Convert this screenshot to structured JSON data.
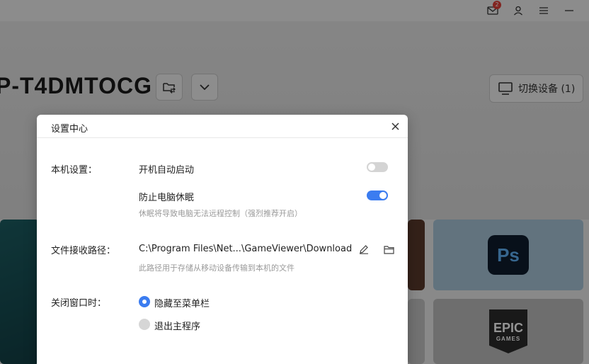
{
  "topbar": {
    "mail_badge": "2",
    "icons": [
      "mail-icon",
      "user-icon",
      "menu-icon",
      "minimize-icon"
    ]
  },
  "device": {
    "name": "P-T4DMTOCG",
    "switch_label": "切换设备 (1)"
  },
  "apps": {
    "ps_label": "Ps",
    "epic_line1": "EPIC",
    "epic_line2": "GAMES"
  },
  "dialog": {
    "title": "设置中心",
    "local_settings": {
      "label": "本机设置：",
      "autostart_label": "开机自动启动",
      "autostart_enabled": false,
      "prevent_sleep_label": "防止电脑休眠",
      "prevent_sleep_enabled": true,
      "prevent_sleep_hint": "休眠将导致电脑无法远程控制（强烈推荐开启）"
    },
    "file_path": {
      "label": "文件接收路径：",
      "value": "C:\\Program Files\\Net...\\GameViewer\\Download",
      "hint": "此路径用于存储从移动设备传输到本机的文件"
    },
    "close_window": {
      "label": "关闭窗口时：",
      "options": [
        {
          "label": "隐藏至菜单栏",
          "selected": true
        },
        {
          "label": "退出主程序",
          "selected": false
        }
      ]
    }
  },
  "colors": {
    "accent": "#3b7cf0",
    "toggle_off": "#d4d4d4",
    "hint_text": "#9a9a9a"
  }
}
